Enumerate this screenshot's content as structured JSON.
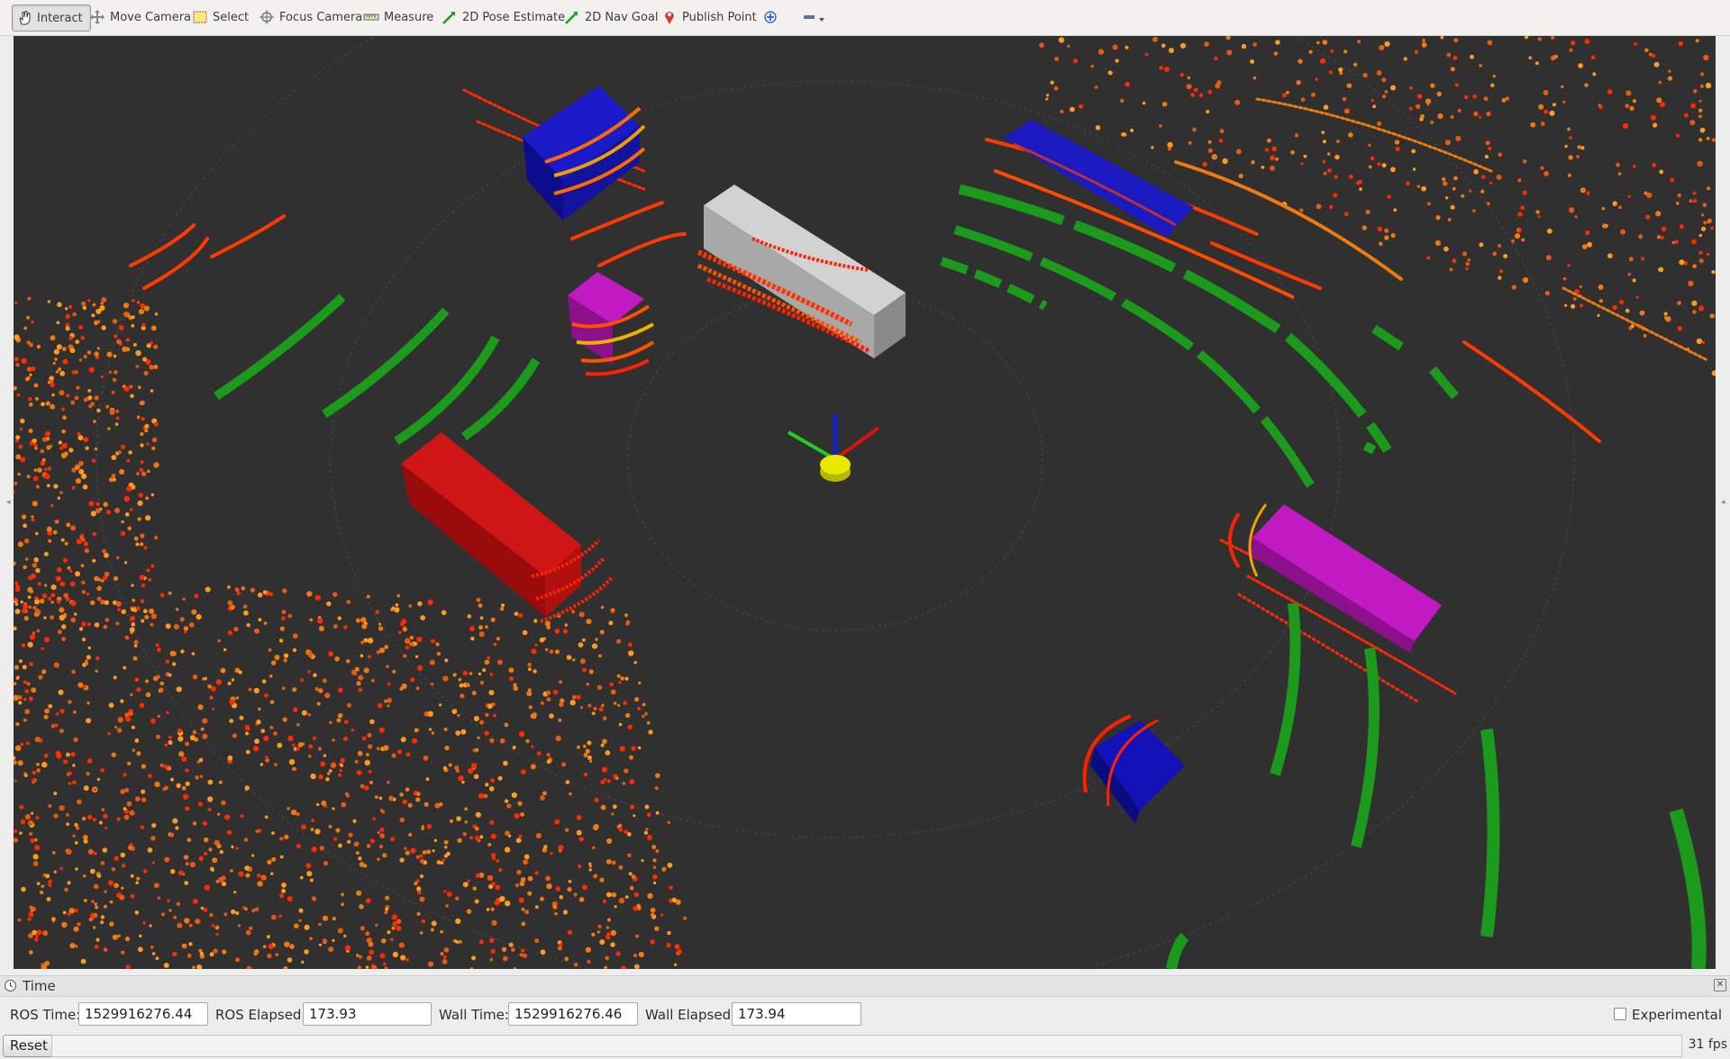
{
  "toolbar": {
    "tools": [
      {
        "label": "Interact",
        "icon": "hand-icon",
        "active": true
      },
      {
        "label": "Move Camera",
        "icon": "move-camera-icon"
      },
      {
        "label": "Select",
        "icon": "select-icon"
      },
      {
        "label": "Focus Camera",
        "icon": "focus-camera-icon"
      },
      {
        "label": "Measure",
        "icon": "ruler-icon"
      },
      {
        "label": "2D Pose Estimate",
        "icon": "green-arrow-icon"
      },
      {
        "label": "2D Nav Goal",
        "icon": "green-arrow-icon"
      },
      {
        "label": "Publish Point",
        "icon": "map-pin-icon"
      }
    ],
    "add_tool_icon": "plus-icon",
    "remove_tool_icon": "minus-icon"
  },
  "viewport": {
    "background": "#303030",
    "colors": {
      "green_boxes": "#1f9a1f",
      "blue_box": "#1010b0",
      "magenta_box": "#c21ac2",
      "red_box": "#c81010",
      "gray_box": "#cfcfcf",
      "points_orange": "#f07a10",
      "points_red": "#ff2a00"
    }
  },
  "time_panel": {
    "title": "Time",
    "ros_time_label": "ROS Time:",
    "ros_time_value": "1529916276.44",
    "ros_elapsed_label": "ROS Elapsed:",
    "ros_elapsed_value": "173.93",
    "wall_time_label": "Wall Time:",
    "wall_time_value": "1529916276.46",
    "wall_elapsed_label": "Wall Elapsed:",
    "wall_elapsed_value": "173.94",
    "experimental_label": "Experimental",
    "experimental_checked": false
  },
  "status_bar": {
    "reset_label": "Reset",
    "fps": "31 fps"
  }
}
